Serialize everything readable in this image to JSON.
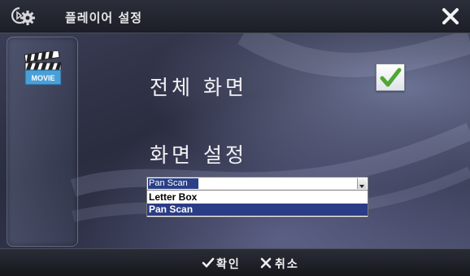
{
  "window": {
    "title": "플레이어 설정"
  },
  "sidebar": {
    "items": [
      {
        "label": "MOVIE",
        "icon": "clapperboard-icon"
      }
    ]
  },
  "settings": {
    "fullscreen": {
      "label": "전체 화면",
      "checked": true
    },
    "screen": {
      "label": "화면 설정",
      "selected": "Pan Scan",
      "options": [
        "Letter Box",
        "Pan Scan"
      ]
    }
  },
  "footer": {
    "ok_label": "확인",
    "cancel_label": "취소"
  },
  "colors": {
    "selection": "#2b3c86",
    "check": "#4fa832"
  }
}
